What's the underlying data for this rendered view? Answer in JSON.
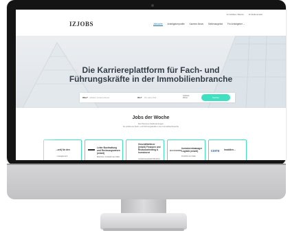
{
  "utility_links": [
    "Immobilien-Talente",
    "IZ-Stellenmarkt"
  ],
  "brand": {
    "logo": "IZJOBS"
  },
  "nav": {
    "items": [
      "Jobsuche",
      "Arbeitgeberprofile",
      "Karriere-News",
      "Stellenangebot",
      "Für Arbeitgeber ⌄"
    ],
    "active_index": 0
  },
  "hero": {
    "title_line1": "Die Karriereplattform für Fach- und",
    "title_line2": "Führungskräfte in der Immobilienbranche"
  },
  "search": {
    "what_label": "Was?",
    "what_placeholder": "Jobtitel, Unternehmen",
    "where_label": "Wo?",
    "where_placeholder": "Ort oder PLZ",
    "radius_line1": "Umkreis",
    "radius_line2": "25 km",
    "button": "Suchen"
  },
  "jobs": {
    "title": "Jobs der Woche",
    "subtitle1": "Die Premium-Stellenanzeigen",
    "subtitle2": "für erfahrene Fach- und Führungskräfte in der Immobilienbranche",
    "cards": [
      {
        "logo": "",
        "title": "...zeit) für den",
        "company": "...management"
      },
      {
        "logo": "",
        "title": "Leiter Buchhaltung und Rechnungswesen (m/w/d)",
        "company": "München, Frankfurt am Main"
      },
      {
        "logo": "",
        "title": "Geschäftsführer (m/w/d) Finanzen und Risikocontrolling & Investment",
        "company": "Landeshauptstadt München"
      },
      {
        "logo": "BACKBONE",
        "title": "Investmentmanager Logistik (m/w/d)",
        "company": "Frankfurt am Main"
      },
      {
        "logo": "corre",
        "title": "Imobilien...",
        "company": ""
      }
    ]
  },
  "colors": {
    "accent": "#3ee0c1",
    "nav_active": "#1a73a8",
    "text_dark": "#333d47"
  }
}
